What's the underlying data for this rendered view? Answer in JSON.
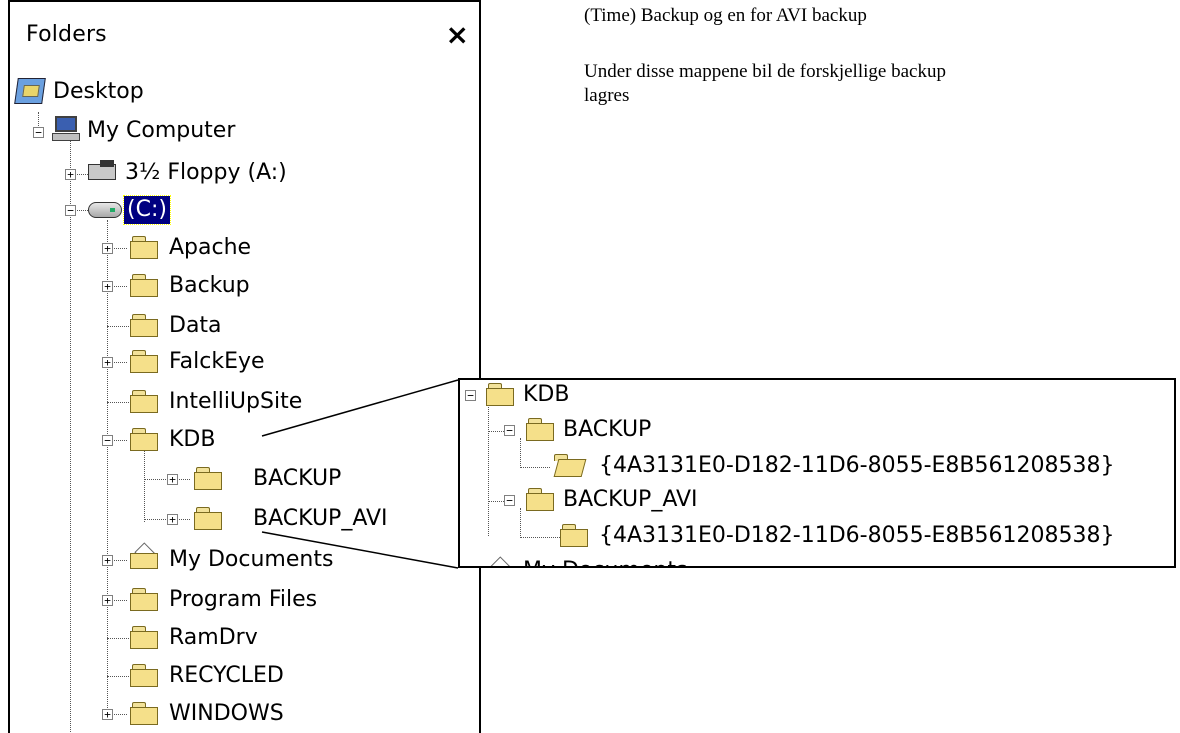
{
  "folders_panel": {
    "title": "Folders",
    "close": "×",
    "tree": {
      "desktop": "Desktop",
      "my_computer": "My Computer",
      "floppy": "3½ Floppy (A:)",
      "drive_c": "(C:)",
      "apache": "Apache",
      "backup": "Backup",
      "data": "Data",
      "falckeye": "FalckEye",
      "intelliupsite": "IntelliUpSite",
      "kdb": "KDB",
      "kdb_backup": "BACKUP",
      "kdb_backup_avi": "BACKUP_AVI",
      "my_documents": "My Documents",
      "program_files": "Program Files",
      "ramdrv": "RamDrv",
      "recycled": "RECYCLED",
      "windows": "WINDOWS"
    },
    "expanders": {
      "plus": "+",
      "minus": "−"
    }
  },
  "notes": {
    "line1": "(Time) Backup og en for AVI backup",
    "line2a": "Under disse mappene bil de forskjellige backup",
    "line2b": "lagres"
  },
  "zoom_inset": {
    "kdb": "KDB",
    "backup": "BACKUP",
    "backup_guid": "{4A3131E0-D182-11D6-8055-E8B561208538}",
    "backup_avi": "BACKUP_AVI",
    "backup_avi_guid": "{4A3131E0-D182-11D6-8055-E8B561208538}",
    "cut_off": "My Documents"
  }
}
